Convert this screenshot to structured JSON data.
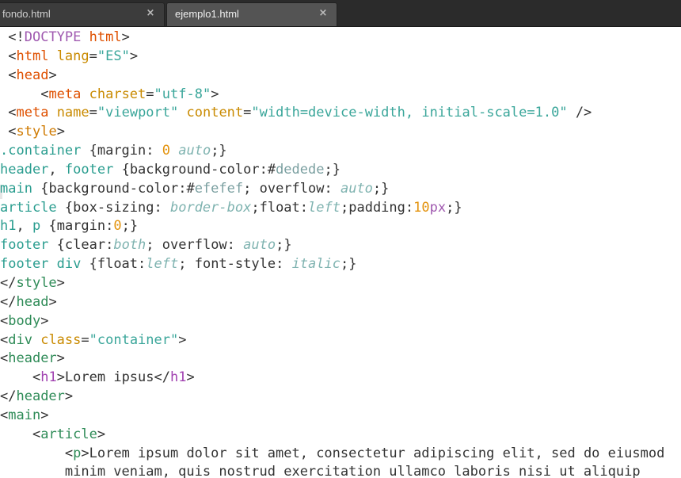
{
  "tabs": [
    {
      "label": "fondo.html",
      "close": "×",
      "active": false
    },
    {
      "label": "ejemplo1.html",
      "close": "×",
      "active": true
    }
  ],
  "colors": {
    "tabbar_bg": "#2b2b2b",
    "active_tab_bg": "#545454",
    "editor_bg": "#ffffff",
    "tag": "#df5000",
    "string": "#3aa69a",
    "selector": "#2a9d8f",
    "keyword": "#7fb3b0",
    "number": "#e3930e"
  },
  "code": {
    "lines": [
      {
        "indent": " ",
        "tokens": [
          [
            "p",
            "<!"
          ],
          [
            "dtd",
            "DOCTYPE "
          ],
          [
            "tag",
            "html"
          ],
          [
            "p",
            ">"
          ]
        ]
      },
      {
        "indent": " ",
        "tokens": [
          [
            "p",
            "<"
          ],
          [
            "tag",
            "html "
          ],
          [
            "attr",
            "lang"
          ],
          [
            "p",
            "="
          ],
          [
            "str",
            "\"ES\""
          ],
          [
            "p",
            ">"
          ]
        ]
      },
      {
        "indent": " ",
        "tokens": [
          [
            "p",
            "<"
          ],
          [
            "tag",
            "head"
          ],
          [
            "p",
            ">"
          ]
        ]
      },
      {
        "indent": "     ",
        "tokens": [
          [
            "p",
            "<"
          ],
          [
            "tag",
            "meta "
          ],
          [
            "attr",
            "charset"
          ],
          [
            "p",
            "="
          ],
          [
            "str",
            "\"utf-8\""
          ],
          [
            "p",
            ">"
          ]
        ]
      },
      {
        "indent": " ",
        "tokens": [
          [
            "p",
            "<"
          ],
          [
            "tag",
            "meta "
          ],
          [
            "attr",
            "name"
          ],
          [
            "p",
            "="
          ],
          [
            "str",
            "\"viewport\""
          ],
          [
            "p",
            " "
          ],
          [
            "attr",
            "content"
          ],
          [
            "p",
            "="
          ],
          [
            "str",
            "\"width=device-width, initial-scale=1.0\""
          ],
          [
            "p",
            " />"
          ]
        ]
      },
      {
        "indent": " ",
        "tokens": [
          [
            "p",
            "<"
          ],
          [
            "tag2",
            "style"
          ],
          [
            "p",
            ">"
          ]
        ]
      },
      {
        "indent": "",
        "tokens": [
          [
            "sel",
            ".container "
          ],
          [
            "p",
            "{"
          ],
          [
            "prop",
            "margin"
          ],
          [
            "p",
            ": "
          ],
          [
            "num",
            "0 "
          ],
          [
            "kw",
            "auto"
          ],
          [
            "p",
            ";}"
          ]
        ]
      },
      {
        "indent": "",
        "tokens": [
          [
            "sel",
            "header"
          ],
          [
            "p",
            ", "
          ],
          [
            "sel",
            "footer "
          ],
          [
            "p",
            "{"
          ],
          [
            "prop",
            "background-color"
          ],
          [
            "p",
            ":#"
          ],
          [
            "hex",
            "dedede"
          ],
          [
            "p",
            ";}"
          ]
        ]
      },
      {
        "indent": "",
        "tokens": [
          [
            "sel",
            "main "
          ],
          [
            "p",
            "{"
          ],
          [
            "prop",
            "background-color"
          ],
          [
            "p",
            ":#"
          ],
          [
            "hex",
            "efefef"
          ],
          [
            "p",
            "; "
          ],
          [
            "prop",
            "overflow"
          ],
          [
            "p",
            ": "
          ],
          [
            "kw",
            "auto"
          ],
          [
            "p",
            ";}"
          ]
        ]
      },
      {
        "indent": "",
        "tokens": [
          [
            "sel",
            "article "
          ],
          [
            "p",
            "{"
          ],
          [
            "prop",
            "box-sizing"
          ],
          [
            "p",
            ": "
          ],
          [
            "kw",
            "border-box"
          ],
          [
            "p",
            ";"
          ],
          [
            "prop",
            "float"
          ],
          [
            "p",
            ":"
          ],
          [
            "kw",
            "left"
          ],
          [
            "p",
            ";"
          ],
          [
            "prop",
            "padding"
          ],
          [
            "p",
            ":"
          ],
          [
            "num",
            "10"
          ],
          [
            "unit",
            "px"
          ],
          [
            "p",
            ";}"
          ]
        ]
      },
      {
        "indent": "",
        "tokens": [
          [
            "sel",
            "h1"
          ],
          [
            "p",
            ", "
          ],
          [
            "sel",
            "p "
          ],
          [
            "p",
            "{"
          ],
          [
            "prop",
            "margin"
          ],
          [
            "p",
            ":"
          ],
          [
            "num",
            "0"
          ],
          [
            "p",
            ";}"
          ]
        ]
      },
      {
        "indent": "",
        "tokens": [
          [
            "sel",
            "footer "
          ],
          [
            "p",
            "{"
          ],
          [
            "prop",
            "clear"
          ],
          [
            "p",
            ":"
          ],
          [
            "kw",
            "both"
          ],
          [
            "p",
            "; "
          ],
          [
            "prop",
            "overflow"
          ],
          [
            "p",
            ": "
          ],
          [
            "kw",
            "auto"
          ],
          [
            "p",
            ";}"
          ]
        ]
      },
      {
        "indent": "",
        "tokens": [
          [
            "sel",
            "footer div "
          ],
          [
            "p",
            "{"
          ],
          [
            "prop",
            "float"
          ],
          [
            "p",
            ":"
          ],
          [
            "kw",
            "left"
          ],
          [
            "p",
            "; "
          ],
          [
            "prop",
            "font-style"
          ],
          [
            "p",
            ": "
          ],
          [
            "kw",
            "italic"
          ],
          [
            "p",
            ";}"
          ]
        ]
      },
      {
        "indent": "",
        "tokens": [
          [
            "p",
            "</"
          ],
          [
            "green",
            "style"
          ],
          [
            "p",
            ">"
          ]
        ]
      },
      {
        "indent": "",
        "tokens": [
          [
            "p",
            "</"
          ],
          [
            "green",
            "head"
          ],
          [
            "p",
            ">"
          ]
        ]
      },
      {
        "indent": "",
        "tokens": [
          [
            "p",
            "<"
          ],
          [
            "green",
            "body"
          ],
          [
            "p",
            ">"
          ]
        ]
      },
      {
        "indent": "",
        "tokens": [
          [
            "p",
            "<"
          ],
          [
            "green",
            "div "
          ],
          [
            "attr",
            "class"
          ],
          [
            "p",
            "="
          ],
          [
            "str",
            "\"container\""
          ],
          [
            "p",
            ">"
          ]
        ]
      },
      {
        "indent": "",
        "tokens": [
          [
            "p",
            "<"
          ],
          [
            "green",
            "header"
          ],
          [
            "p",
            ">"
          ]
        ]
      },
      {
        "indent": "    ",
        "tokens": [
          [
            "p",
            "<"
          ],
          [
            "h1",
            "h1"
          ],
          [
            "p",
            ">Lorem ipsus</"
          ],
          [
            "h1",
            "h1"
          ],
          [
            "p",
            ">"
          ]
        ]
      },
      {
        "indent": "",
        "tokens": [
          [
            "p",
            "</"
          ],
          [
            "green",
            "header"
          ],
          [
            "p",
            ">"
          ]
        ]
      },
      {
        "indent": "",
        "tokens": [
          [
            "p",
            "<"
          ],
          [
            "green",
            "main"
          ],
          [
            "p",
            ">"
          ]
        ]
      },
      {
        "indent": "    ",
        "tokens": [
          [
            "p",
            "<"
          ],
          [
            "green",
            "article"
          ],
          [
            "p",
            ">"
          ]
        ]
      },
      {
        "indent": "        ",
        "tokens": [
          [
            "p",
            "<"
          ],
          [
            "green",
            "p"
          ],
          [
            "p",
            ">Lorem ipsum dolor sit amet, consectetur adipiscing elit, sed do eiusmod"
          ]
        ]
      },
      {
        "indent": "        ",
        "tokens": [
          [
            "p",
            "minim veniam, quis nostrud exercitation ullamco laboris nisi ut aliquip"
          ]
        ]
      }
    ]
  }
}
